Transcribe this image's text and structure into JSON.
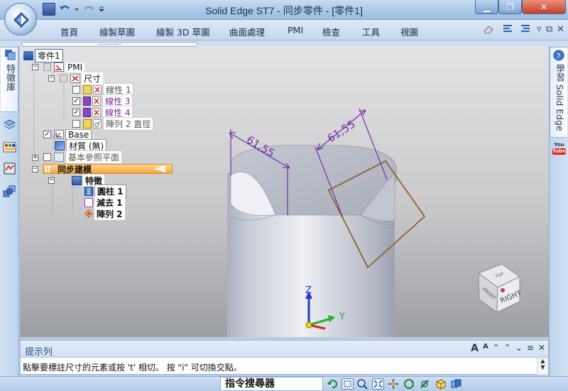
{
  "window": {
    "title": "Solid Edge ST7 - 同步零件 - [零件1]",
    "minimize_label": "▁",
    "maximize_label": "❐",
    "close_label": "✕"
  },
  "menu": {
    "items": [
      "首頁",
      "繪製草圖",
      "繪製 3D 草圖",
      "曲面處理",
      "PMI",
      "檢查",
      "工具",
      "視圖"
    ],
    "right_controls": [
      "▿",
      "⧉",
      "✕"
    ]
  },
  "left_tabs": {
    "feature_library_label": "特徵庫",
    "icons": [
      "feature-library-icon",
      "layers-icon",
      "palette-icon",
      "sensors-icon",
      "assembly-icon"
    ]
  },
  "right_tabs": {
    "learn_label": "學習 Solid Edge",
    "youtube_label": "You Tube"
  },
  "tree": {
    "root": "零件1",
    "pmi": "PMI",
    "dimensions": "尺寸",
    "linear1": "線性 1",
    "linear3": "線性 3",
    "linear4": "線性 4",
    "pattern_diameter": "陣列 2 直徑",
    "base": "Base",
    "material": "材質 (無)",
    "ref_planes": "基本參照平面",
    "sync_modeling": "同步建模",
    "features": "特徵",
    "cylinder": "圓柱 1",
    "cut": "減去 1",
    "pattern": "陣列 2"
  },
  "viewport": {
    "dim_left": "61,55",
    "dim_right": "61,55",
    "axis_z": "Z",
    "axis_y": "Y",
    "cube_front": "FRONT",
    "cube_right": "RIGHT",
    "cube_top": "TOP"
  },
  "tip_panel": {
    "title": "提示列",
    "text": "點擊要標註尺寸的元素或按 't' 相切。  按 \"i\" 可切換交點。",
    "controls": [
      "A",
      "A",
      "⌃",
      "⌃",
      "⌄",
      "≡",
      "✕"
    ]
  },
  "status": {
    "command_finder": "指令搜尋器"
  },
  "colors": {
    "accent_blue": "#2c4d85",
    "dim_purple": "#7a2ca6",
    "sync_orange": "#f7a63c",
    "sketch_brown": "#8a5a1a"
  }
}
